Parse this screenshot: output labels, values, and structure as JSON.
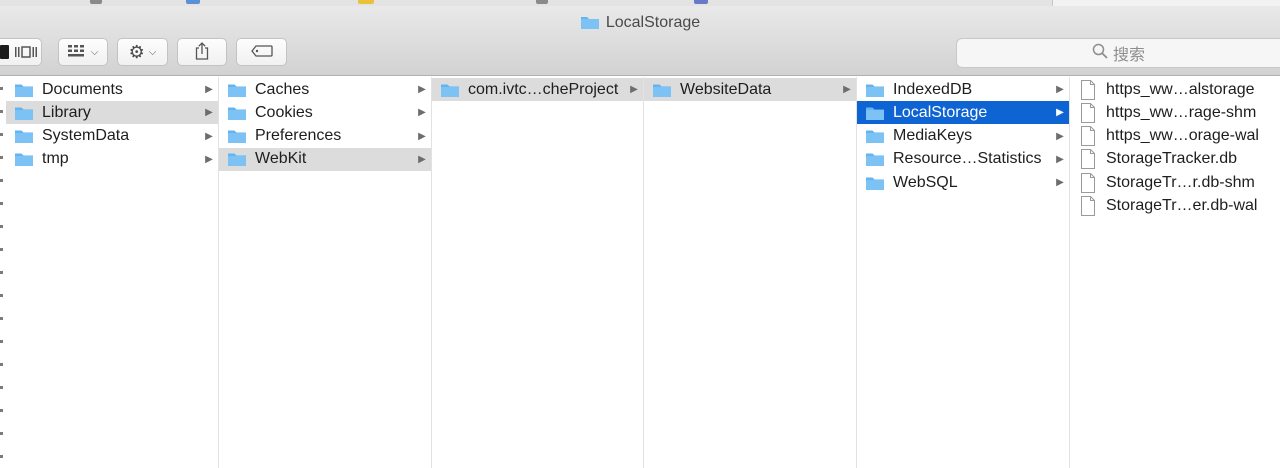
{
  "window": {
    "title": "LocalStorage",
    "accent": "#0e64d2",
    "folder_color": "#64b4f0"
  },
  "toolbar": {
    "view_column_icon": "column-view-icon",
    "view_coverflow_icon": "coverflow-view-icon",
    "arrange_icon": "grid-arrange-icon",
    "action_icon": "gear-icon",
    "share_icon": "share-icon",
    "tag_icon": "tag-icon"
  },
  "search": {
    "placeholder": "搜索"
  },
  "columns": [
    {
      "items": [
        {
          "label": "Documents",
          "type": "folder",
          "state": "none"
        },
        {
          "label": "Library",
          "type": "folder",
          "state": "path"
        },
        {
          "label": "SystemData",
          "type": "folder",
          "state": "none"
        },
        {
          "label": "tmp",
          "type": "folder",
          "state": "none"
        }
      ]
    },
    {
      "items": [
        {
          "label": "Caches",
          "type": "folder",
          "state": "none"
        },
        {
          "label": "Cookies",
          "type": "folder",
          "state": "none"
        },
        {
          "label": "Preferences",
          "type": "folder",
          "state": "none"
        },
        {
          "label": "WebKit",
          "type": "folder",
          "state": "path"
        }
      ]
    },
    {
      "items": [
        {
          "label": "com.ivtc…cheProject",
          "type": "folder",
          "state": "path"
        }
      ]
    },
    {
      "items": [
        {
          "label": "WebsiteData",
          "type": "folder",
          "state": "path"
        }
      ]
    },
    {
      "items": [
        {
          "label": "IndexedDB",
          "type": "folder",
          "state": "none"
        },
        {
          "label": "LocalStorage",
          "type": "folder",
          "state": "selected"
        },
        {
          "label": "MediaKeys",
          "type": "folder",
          "state": "none"
        },
        {
          "label": "Resource…Statistics",
          "type": "folder",
          "state": "none"
        },
        {
          "label": "WebSQL",
          "type": "folder",
          "state": "none"
        }
      ]
    },
    {
      "items": [
        {
          "label": "https_ww…alstorage",
          "type": "file",
          "state": "none"
        },
        {
          "label": "https_ww…rage-shm",
          "type": "file",
          "state": "none"
        },
        {
          "label": "https_ww…orage-wal",
          "type": "file",
          "state": "none"
        },
        {
          "label": "StorageTracker.db",
          "type": "file",
          "state": "none"
        },
        {
          "label": "StorageTr…r.db-shm",
          "type": "file",
          "state": "none"
        },
        {
          "label": "StorageTr…er.db-wal",
          "type": "file",
          "state": "none"
        }
      ]
    }
  ]
}
